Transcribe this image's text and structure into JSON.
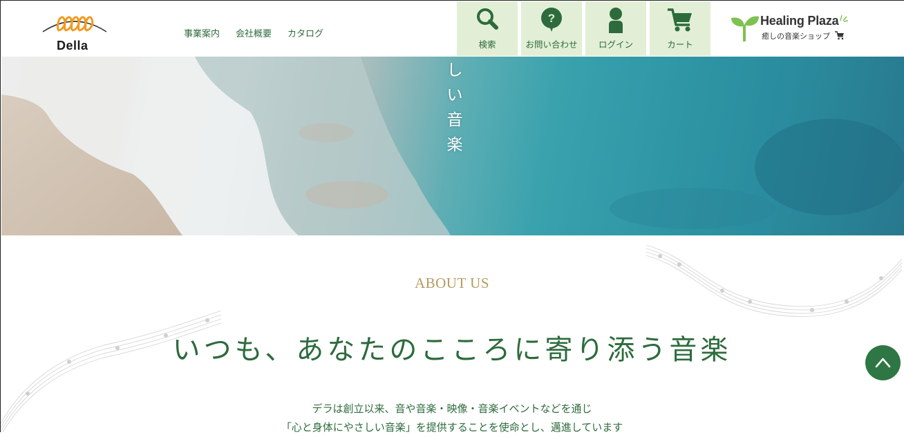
{
  "header": {
    "logo_text": "Della",
    "nav": [
      {
        "label": "事業案内"
      },
      {
        "label": "会社概要"
      },
      {
        "label": "カタログ"
      }
    ],
    "tools": [
      {
        "label": "検索",
        "icon": "search-icon"
      },
      {
        "label": "お問い合わせ",
        "icon": "question-bubble-icon"
      },
      {
        "label": "ログイン",
        "icon": "person-icon"
      },
      {
        "label": "カート",
        "icon": "cart-icon"
      }
    ],
    "healing_plaza": {
      "title": "Healing Plaza",
      "subtitle": "癒しの音楽ショップ"
    }
  },
  "hero": {
    "vertical_text": [
      "し",
      "い",
      "音",
      "楽"
    ]
  },
  "about": {
    "heading": "ABOUT US",
    "catchphrase": "いつも、あなたのこころに寄り添う音楽",
    "lines": [
      "デラは創立以来、音や音楽・映像・音楽イベントなどを通じ",
      "「心と身体にやさしい音楽」を提供することを使命とし、邁進しています"
    ]
  },
  "colors": {
    "brand_green": "#2d6b3c",
    "tool_bg": "#e2efd6",
    "accent_gold": "#b59a5e",
    "logo_orange": "#f29a1f",
    "to_top_button": "#2e7744"
  }
}
